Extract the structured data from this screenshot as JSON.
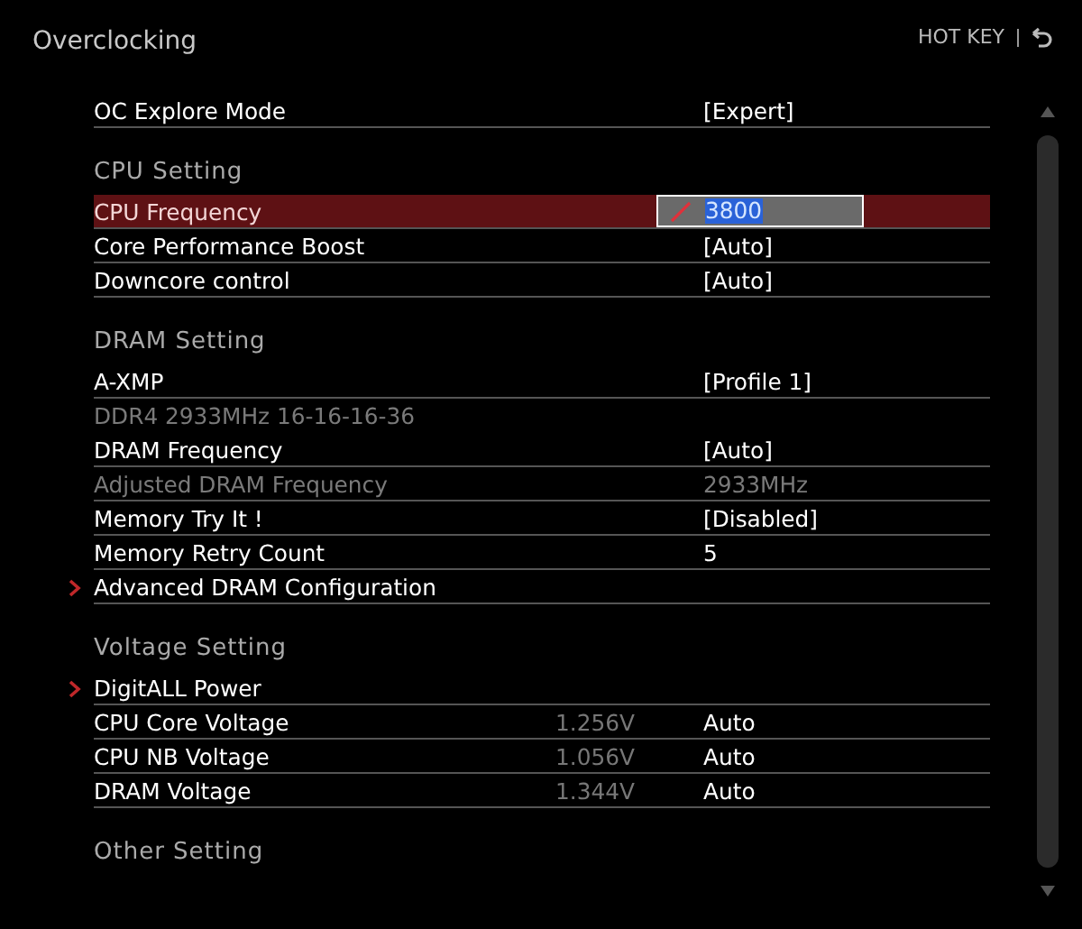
{
  "title": "Overclocking",
  "hot_key": {
    "label": "HOT KEY"
  },
  "rows": [
    {
      "kind": "setting",
      "label": "OC Explore Mode",
      "value": "[Expert]",
      "selected": false,
      "disabled": false
    },
    {
      "kind": "header",
      "label": "CPU  Setting"
    },
    {
      "kind": "input",
      "label": "CPU Frequency",
      "value": "3800",
      "selected": true,
      "disabled": false
    },
    {
      "kind": "setting",
      "label": "Core Performance Boost",
      "value": "[Auto]",
      "selected": false,
      "disabled": false
    },
    {
      "kind": "setting",
      "label": "Downcore control",
      "value": "[Auto]",
      "selected": false,
      "disabled": false
    },
    {
      "kind": "header",
      "label": "DRAM  Setting"
    },
    {
      "kind": "setting",
      "label": "A-XMP",
      "value": "[Profile 1]",
      "selected": false,
      "disabled": false
    },
    {
      "kind": "info",
      "label": "DDR4 2933MHz 16-16-16-36"
    },
    {
      "kind": "setting",
      "label": "DRAM Frequency",
      "value": "[Auto]",
      "selected": false,
      "disabled": false
    },
    {
      "kind": "setting",
      "label": "Adjusted DRAM Frequency",
      "value": "2933MHz",
      "selected": false,
      "disabled": true
    },
    {
      "kind": "setting",
      "label": "Memory Try It !",
      "value": "[Disabled]",
      "selected": false,
      "disabled": false
    },
    {
      "kind": "setting",
      "label": "Memory Retry Count",
      "value": "5",
      "selected": false,
      "disabled": false
    },
    {
      "kind": "submenu",
      "label": "Advanced DRAM Configuration",
      "selected": false,
      "disabled": false
    },
    {
      "kind": "header",
      "label": "Voltage  Setting"
    },
    {
      "kind": "submenu",
      "label": "DigitALL Power",
      "selected": false,
      "disabled": false
    },
    {
      "kind": "setting",
      "label": "CPU Core Voltage",
      "reading": "1.256V",
      "value": "Auto",
      "selected": false,
      "disabled": false
    },
    {
      "kind": "setting",
      "label": "CPU NB Voltage",
      "reading": "1.056V",
      "value": "Auto",
      "selected": false,
      "disabled": false
    },
    {
      "kind": "setting",
      "label": "DRAM Voltage",
      "reading": "1.344V",
      "value": "Auto",
      "selected": false,
      "disabled": false
    },
    {
      "kind": "header",
      "label": "Other  Setting"
    }
  ]
}
